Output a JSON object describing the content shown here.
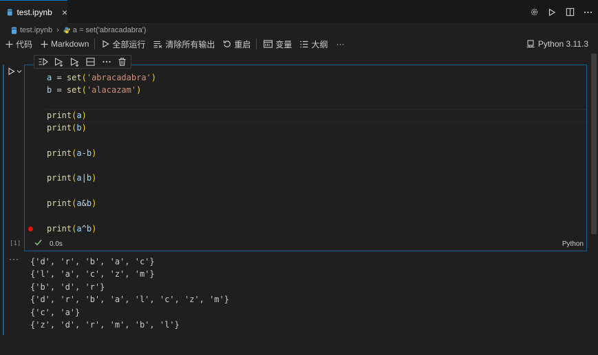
{
  "tab": {
    "label": "test.ipynb",
    "close": "×"
  },
  "breadcrumb": {
    "file": "test.ipynb",
    "symbol": "a = set('abracadabra')"
  },
  "toolbar": {
    "code": "代码",
    "markdown": "Markdown",
    "run_all": "全部运行",
    "clear_outputs": "清除所有输出",
    "restart": "重启",
    "variables": "变量",
    "outline": "大纲",
    "more": "···"
  },
  "kernel": "Python 3.11.3",
  "cell": {
    "exec_count": "[1]",
    "duration": "0.0s",
    "language": "Python",
    "code_lines": [
      "a = set('abracadabra')",
      "b = set('alacazam')",
      "",
      "print(a)",
      "print(b)",
      "",
      "print(a-b)",
      "",
      "print(a|b)",
      "",
      "print(a&b)",
      "",
      "print(a^b)"
    ]
  },
  "output": {
    "more": "···",
    "lines": [
      "{'d', 'r', 'b', 'a', 'c'}",
      "{'l', 'a', 'c', 'z', 'm'}",
      "{'b', 'd', 'r'}",
      "{'d', 'r', 'b', 'a', 'l', 'c', 'z', 'm'}",
      "{'c', 'a'}",
      "{'z', 'd', 'r', 'm', 'b', 'l'}"
    ]
  },
  "colors": {
    "accent": "#0e639c",
    "keyword_fn": "#dcdcaa",
    "string": "#ce9178",
    "variable": "#9cdcfe",
    "breakpoint": "#e51400",
    "success": "#89d185"
  }
}
